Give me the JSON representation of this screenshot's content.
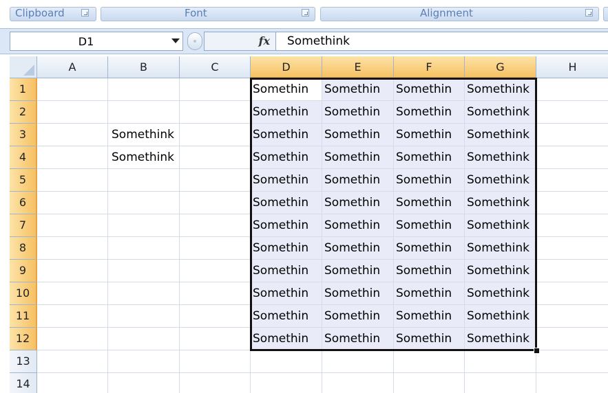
{
  "ribbon": {
    "groups": [
      {
        "label": "Clipboard"
      },
      {
        "label": "Font"
      },
      {
        "label": "Alignment"
      }
    ]
  },
  "formula_bar": {
    "name_box_value": "D1",
    "fx_label": "fx",
    "formula_value": "Somethink"
  },
  "sheet": {
    "columns": [
      "A",
      "B",
      "C",
      "D",
      "E",
      "F",
      "G",
      "H"
    ],
    "rows": [
      "1",
      "2",
      "3",
      "4",
      "5",
      "6",
      "7",
      "8",
      "9",
      "10",
      "11",
      "12",
      "13",
      "14"
    ],
    "selected_columns": [
      "D",
      "E",
      "F",
      "G"
    ],
    "selected_rows": [
      "1",
      "2",
      "3",
      "4",
      "5",
      "6",
      "7",
      "8",
      "9",
      "10",
      "11",
      "12"
    ],
    "selection_range": "D1:G12",
    "cell_text": "Somethink",
    "clipped_text": "Somethin",
    "b_cells": [
      {
        "row": "3",
        "value": "Somethink"
      },
      {
        "row": "4",
        "value": "Somethink"
      }
    ]
  },
  "colors": {
    "header_selected": "#f6c163",
    "selection_fill": "#e9ecf8",
    "grid_line": "#d3dce8",
    "formula_bar_bg": "#dbe7f6"
  }
}
